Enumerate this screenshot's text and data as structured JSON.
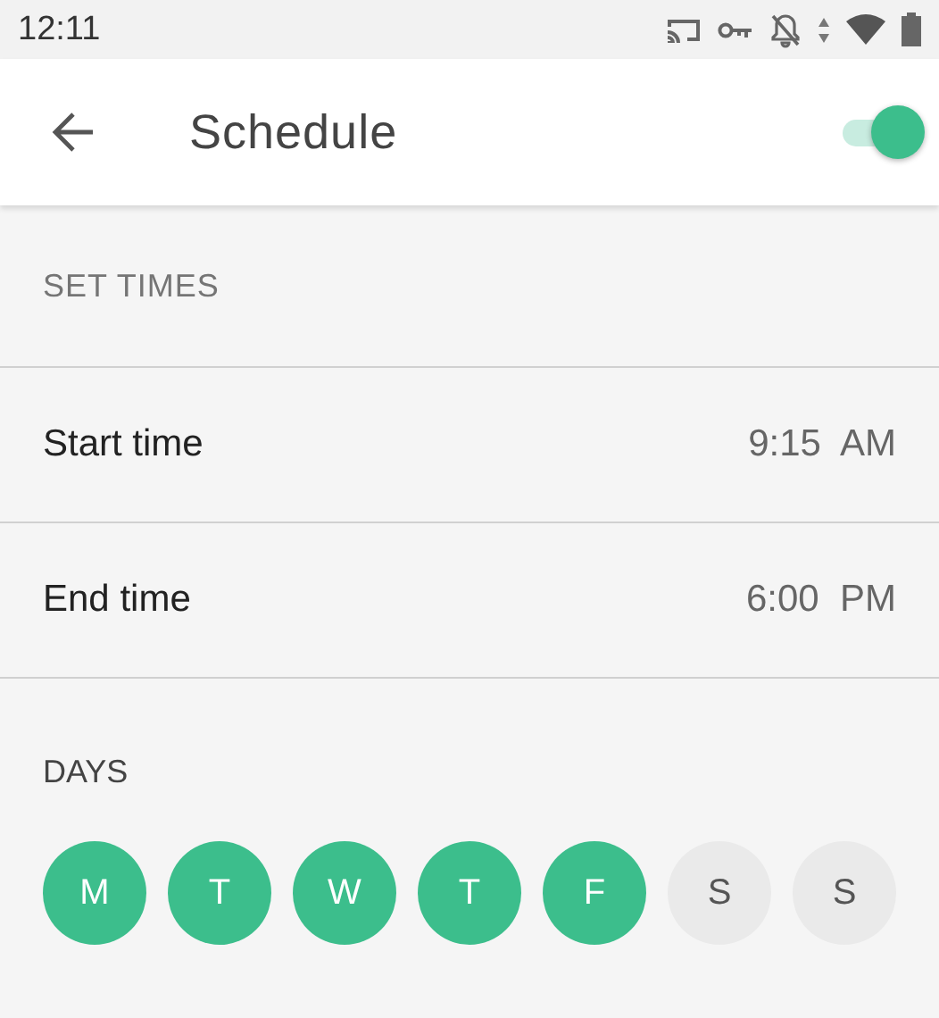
{
  "status_bar": {
    "time": "12:11"
  },
  "app_bar": {
    "title": "Schedule",
    "toggle": {
      "on": true
    }
  },
  "sections": [
    {
      "header": "SET TIMES",
      "rows": [
        {
          "label": "Start time",
          "value": "9:15  AM"
        },
        {
          "label": "End time",
          "value": "6:00  PM"
        }
      ]
    }
  ],
  "days": {
    "header": "DAYS",
    "items": [
      {
        "label": "M",
        "selected": true
      },
      {
        "label": "T",
        "selected": true
      },
      {
        "label": "W",
        "selected": true
      },
      {
        "label": "T",
        "selected": true
      },
      {
        "label": "F",
        "selected": true
      },
      {
        "label": "S",
        "selected": false
      },
      {
        "label": "S",
        "selected": false
      }
    ]
  }
}
